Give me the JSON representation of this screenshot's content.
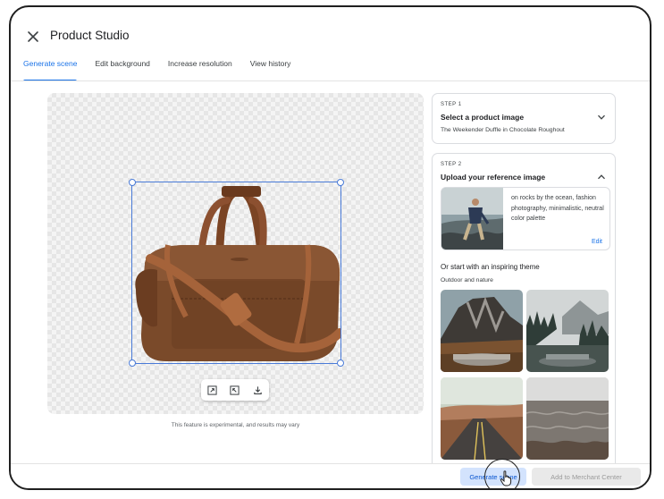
{
  "header": {
    "title": "Product Studio",
    "close_icon": "close-icon"
  },
  "tabs": [
    {
      "label": "Generate scene",
      "active": true
    },
    {
      "label": "Edit background",
      "active": false
    },
    {
      "label": "Increase resolution",
      "active": false
    },
    {
      "label": "View history",
      "active": false
    }
  ],
  "canvas": {
    "toolbar_icons": [
      "expand-icon",
      "shrink-icon",
      "download-icon"
    ],
    "disclaimer": "This feature is experimental, and results may vary"
  },
  "step1": {
    "label": "STEP 1",
    "title": "Select a product image",
    "subtitle": "The Weekender Duffle in Chocolate Roughout",
    "expanded": false
  },
  "step2": {
    "label": "STEP 2",
    "title": "Upload your reference image",
    "expanded": true,
    "reference_prompt": "on rocks by the ocean, fashion photography, minimalistic, neutral color palette",
    "edit_label": "Edit",
    "theme_heading": "Or start with an inspiring theme",
    "theme_category": "Outdoor and nature",
    "themes": [
      "mountain-rock-theme",
      "misty-forest-rock-theme",
      "desert-road-theme",
      "ocean-water-theme"
    ]
  },
  "footer": {
    "generate_label": "Generate scene",
    "merchant_label": "Add to Merchant Center"
  },
  "colors": {
    "accent": "#1a73e8",
    "generate_bg": "#d3e3fd",
    "bag": "#7a4a2a"
  }
}
